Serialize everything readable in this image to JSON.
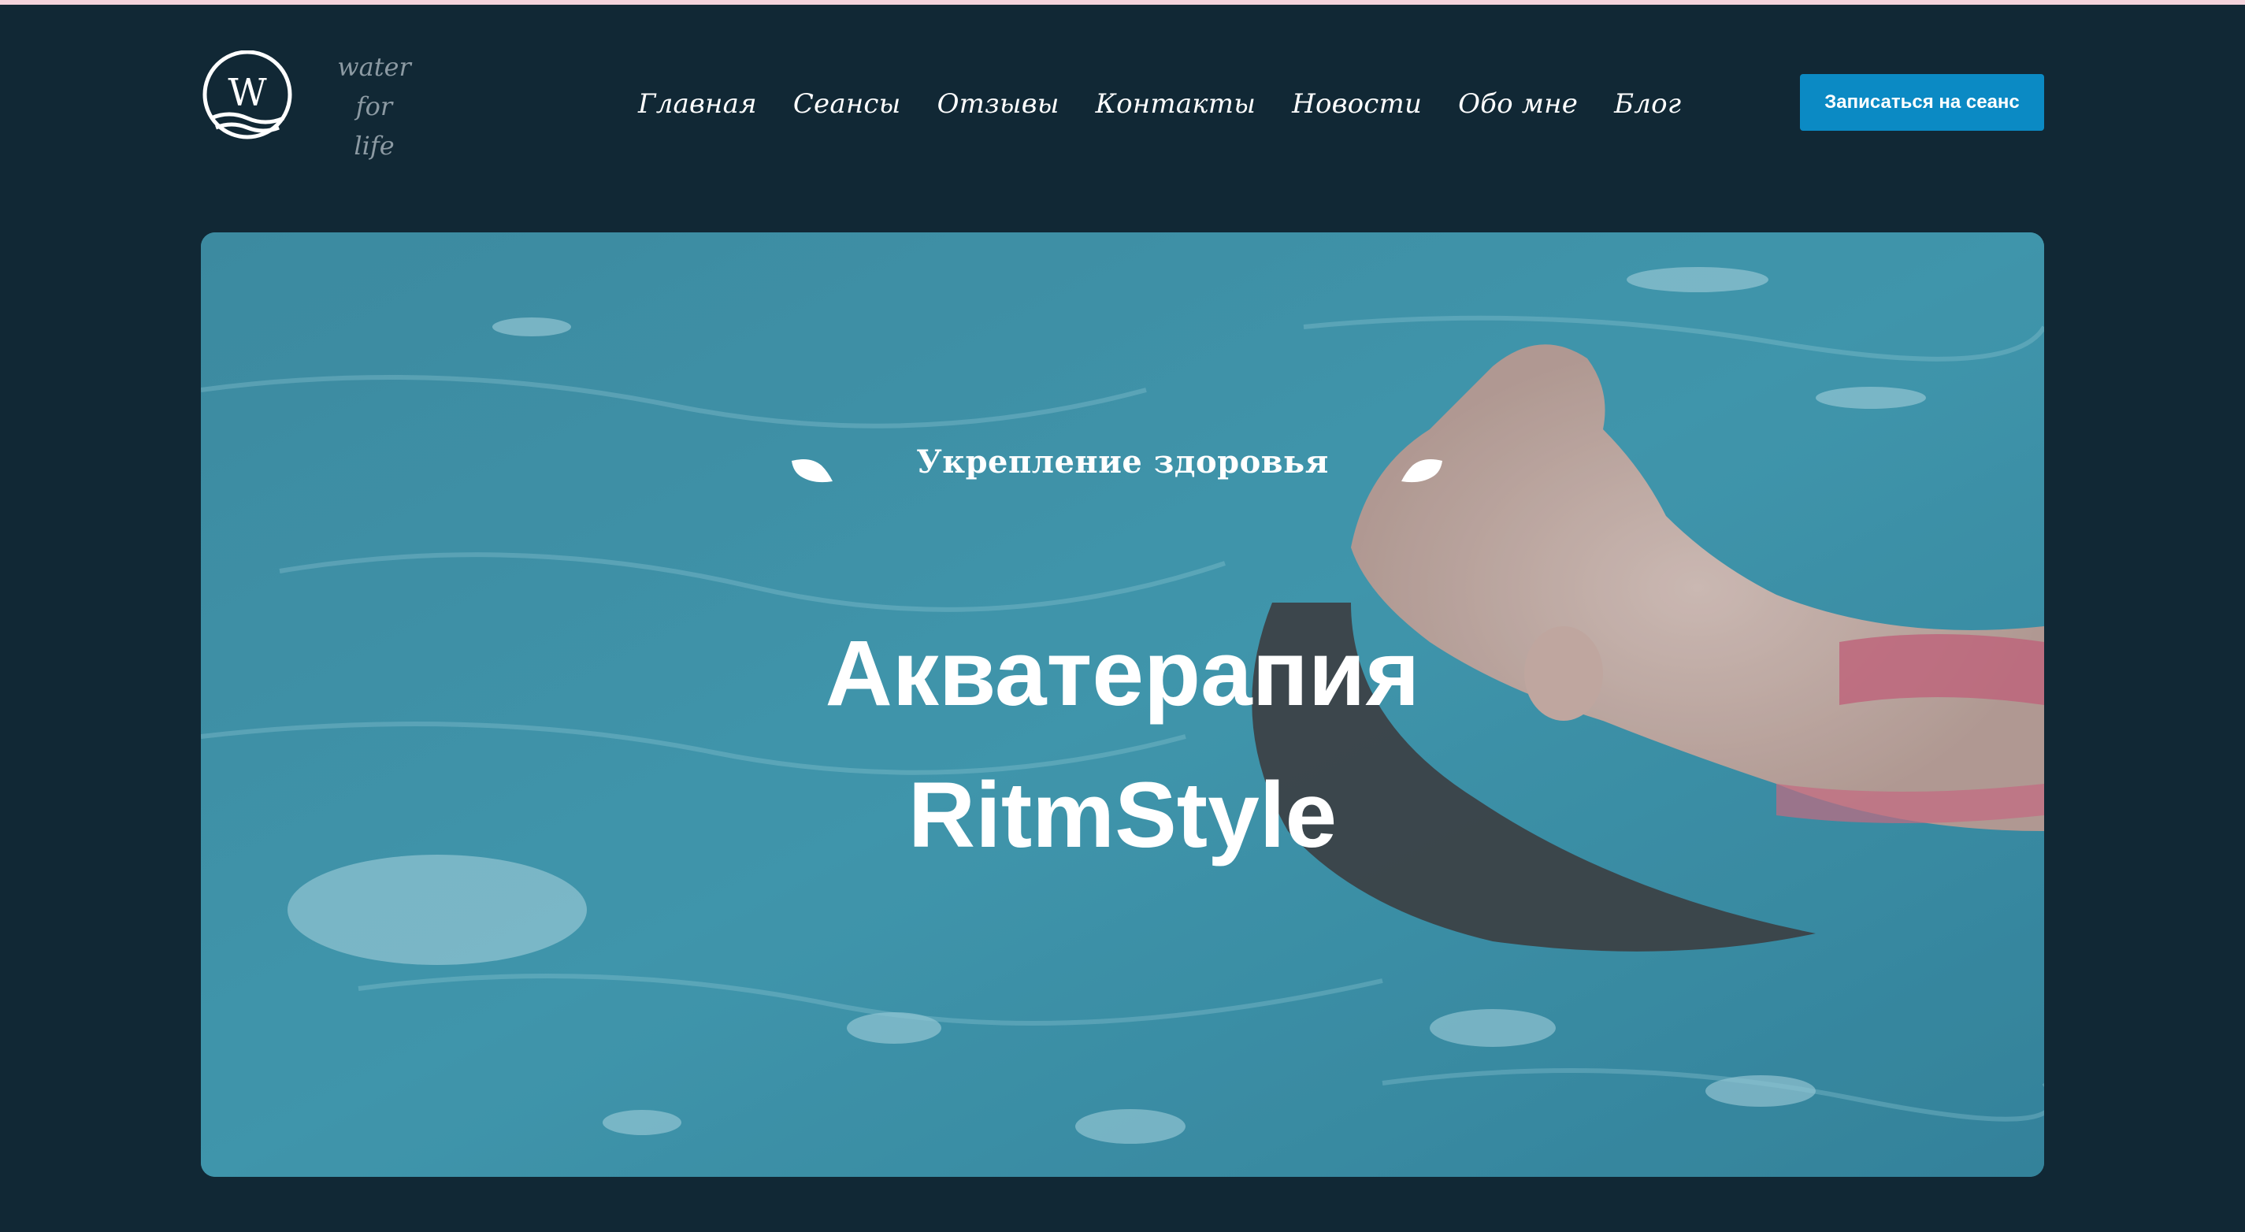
{
  "logo": {
    "letter": "W",
    "lines": [
      "water",
      "for",
      "life"
    ]
  },
  "nav": {
    "items": [
      "Главная",
      "Сеансы",
      "Отзывы",
      "Контакты",
      "Новости",
      "Обо мне",
      "Блог"
    ]
  },
  "header": {
    "cta_label": "Записаться на сеанс"
  },
  "hero": {
    "subtitle": "Укрепление здоровья",
    "title_line1": "Акватерапия",
    "title_line2": "RitmStyle"
  },
  "colors": {
    "background": "#112835",
    "accent": "#0b8ac4",
    "top_strip": "#f4d4dc"
  },
  "icons": {
    "logo": "wave-logo-icon",
    "quote_open": "quote-open-icon",
    "quote_close": "quote-close-icon"
  }
}
